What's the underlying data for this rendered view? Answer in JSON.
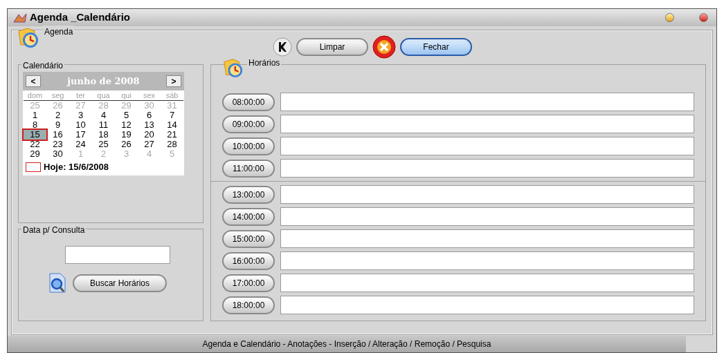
{
  "window": {
    "title": "Agenda _Calendário"
  },
  "agenda": {
    "legend": "Agenda",
    "buttons": [
      {
        "kind": "icon"
      },
      {
        "kind": "text",
        "label": "Limpar"
      },
      {
        "kind": "close"
      },
      {
        "kind": "text",
        "label": "Fechar",
        "selected": true
      }
    ]
  },
  "calendar": {
    "legend": "Calendário",
    "month_label": "junho de 2008",
    "prev": "<",
    "next": ">",
    "weekdays": [
      "dom",
      "seg",
      "ter",
      "qua",
      "qui",
      "sex",
      "sáb"
    ],
    "weeks": [
      [
        {
          "day": "25",
          "other_month": true,
          "selected": false
        },
        {
          "day": "26",
          "other_month": true,
          "selected": false
        },
        {
          "day": "27",
          "other_month": true,
          "selected": false
        },
        {
          "day": "28",
          "other_month": true,
          "selected": false
        },
        {
          "day": "29",
          "other_month": true,
          "selected": false
        },
        {
          "day": "30",
          "other_month": true,
          "selected": false
        },
        {
          "day": "31",
          "other_month": true,
          "selected": false
        }
      ],
      [
        {
          "day": "1",
          "other_month": false,
          "selected": false
        },
        {
          "day": "2",
          "other_month": false,
          "selected": false
        },
        {
          "day": "3",
          "other_month": false,
          "selected": false
        },
        {
          "day": "4",
          "other_month": false,
          "selected": false
        },
        {
          "day": "5",
          "other_month": false,
          "selected": false
        },
        {
          "day": "6",
          "other_month": false,
          "selected": false
        },
        {
          "day": "7",
          "other_month": false,
          "selected": false
        }
      ],
      [
        {
          "day": "8",
          "other_month": false,
          "selected": false
        },
        {
          "day": "9",
          "other_month": false,
          "selected": false
        },
        {
          "day": "10",
          "other_month": false,
          "selected": false
        },
        {
          "day": "11",
          "other_month": false,
          "selected": false
        },
        {
          "day": "12",
          "other_month": false,
          "selected": false
        },
        {
          "day": "13",
          "other_month": false,
          "selected": false
        },
        {
          "day": "14",
          "other_month": false,
          "selected": false
        }
      ],
      [
        {
          "day": "15",
          "other_month": false,
          "selected": true
        },
        {
          "day": "16",
          "other_month": false,
          "selected": false
        },
        {
          "day": "17",
          "other_month": false,
          "selected": false
        },
        {
          "day": "18",
          "other_month": false,
          "selected": false
        },
        {
          "day": "19",
          "other_month": false,
          "selected": false
        },
        {
          "day": "20",
          "other_month": false,
          "selected": false
        },
        {
          "day": "21",
          "other_month": false,
          "selected": false
        }
      ],
      [
        {
          "day": "22",
          "other_month": false,
          "selected": false
        },
        {
          "day": "23",
          "other_month": false,
          "selected": false
        },
        {
          "day": "24",
          "other_month": false,
          "selected": false
        },
        {
          "day": "25",
          "other_month": false,
          "selected": false
        },
        {
          "day": "26",
          "other_month": false,
          "selected": false
        },
        {
          "day": "27",
          "other_month": false,
          "selected": false
        },
        {
          "day": "28",
          "other_month": false,
          "selected": false
        }
      ],
      [
        {
          "day": "29",
          "other_month": false,
          "selected": false
        },
        {
          "day": "30",
          "other_month": false,
          "selected": false
        },
        {
          "day": "1",
          "other_month": true,
          "selected": false
        },
        {
          "day": "2",
          "other_month": true,
          "selected": false
        },
        {
          "day": "3",
          "other_month": true,
          "selected": false
        },
        {
          "day": "4",
          "other_month": true,
          "selected": false
        },
        {
          "day": "5",
          "other_month": true,
          "selected": false
        }
      ]
    ],
    "today_label": "Hoje: 15/6/2008"
  },
  "query": {
    "legend": "Data p/ Consulta",
    "button": "Buscar Horários"
  },
  "schedule": {
    "legend": "Horários",
    "groups": [
      [
        {
          "time": "08:00:00"
        },
        {
          "time": "09:00:00"
        },
        {
          "time": "10:00:00"
        },
        {
          "time": "11:00:00"
        }
      ],
      [
        {
          "time": "13:00:00"
        },
        {
          "time": "14:00:00"
        },
        {
          "time": "15:00:00"
        },
        {
          "time": "16:00:00"
        },
        {
          "time": "17:00:00"
        },
        {
          "time": "18:00:00"
        }
      ]
    ]
  },
  "status_bar": "Agenda e Calendário - Anotações - Inserção / Alteração / Remoção / Pesquisa"
}
